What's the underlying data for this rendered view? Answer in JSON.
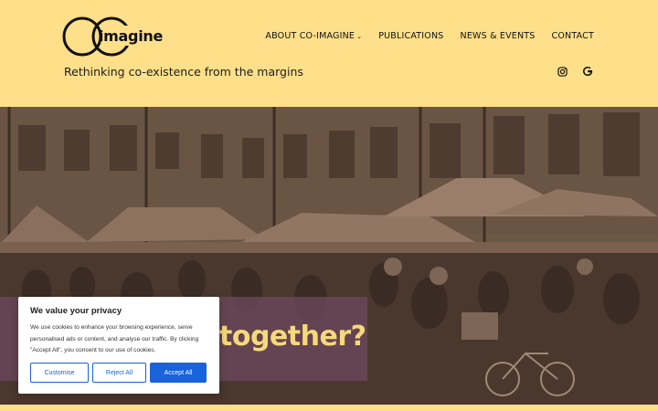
{
  "site": {
    "logo_text": "imagine",
    "logo_alt": "CO imagine",
    "tagline": "Rethinking co-existence from the margins"
  },
  "nav": {
    "items": [
      {
        "label": "ABOUT CO-IMAGINE",
        "has_dropdown": true
      },
      {
        "label": "PUBLICATIONS",
        "has_dropdown": false
      },
      {
        "label": "NEWS & EVENTS",
        "has_dropdown": false
      },
      {
        "label": "CONTACT",
        "has_dropdown": false
      }
    ],
    "dropdown_glyph": "⌄"
  },
  "social": {
    "icons": [
      "instagram-icon",
      "google-icon"
    ]
  },
  "hero": {
    "heading": "together?"
  },
  "cookie": {
    "title": "We value your privacy",
    "body": "We use cookies to enhance your browsing experience, serve personalised ads or content, and analyse our traffic. By clicking \"Accept All\", you consent to our use of cookies.",
    "customise_label": "Customise",
    "reject_label": "Reject All",
    "accept_label": "Accept All"
  },
  "colors": {
    "brand_yellow": "#fedf8a",
    "hero_overlay": "#6c485c",
    "hero_text": "#f5d97d",
    "consent_blue": "#1863dc"
  }
}
